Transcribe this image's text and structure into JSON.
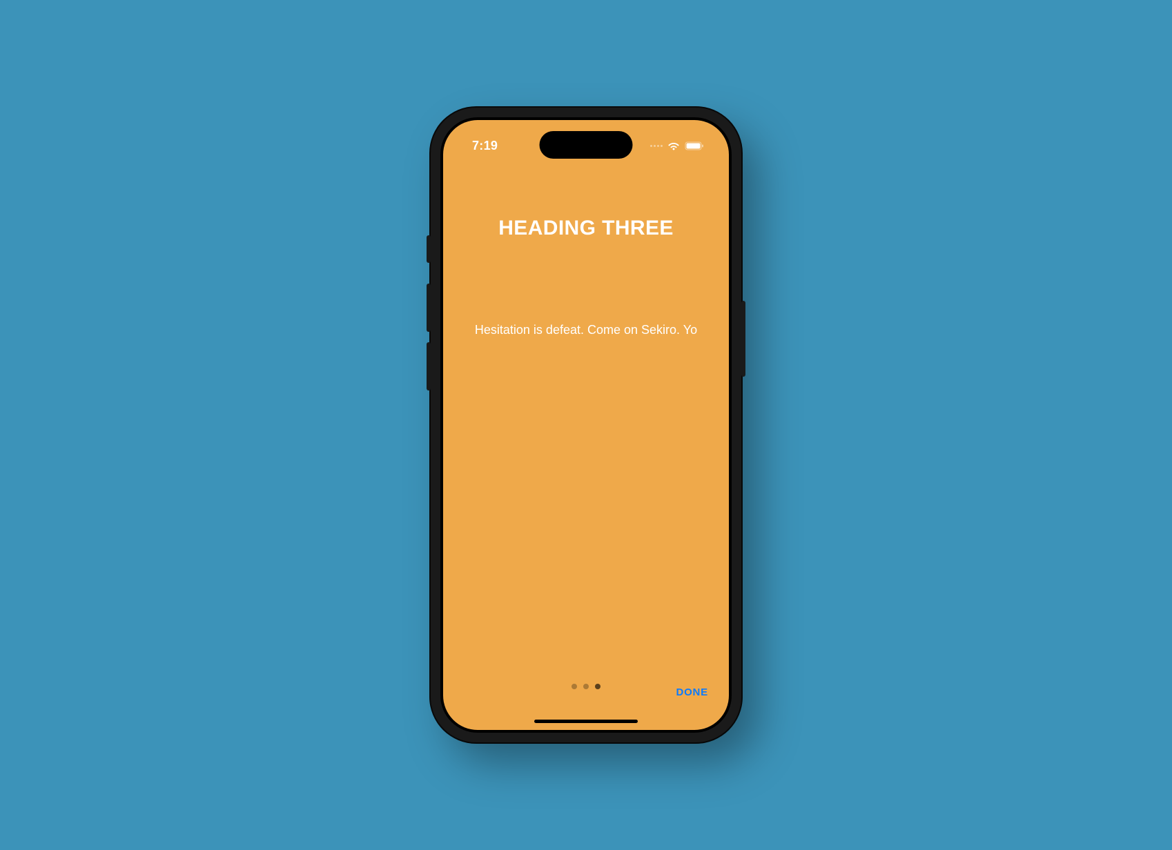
{
  "status_bar": {
    "time": "7:19"
  },
  "content": {
    "heading": "HEADING THREE",
    "body": "Hesitation is defeat. Come on Sekiro. Yo"
  },
  "pager": {
    "total": 3,
    "active_index": 2
  },
  "actions": {
    "done_label": "DONE"
  },
  "colors": {
    "page_background": "#3c93b9",
    "screen_background": "#efa94a",
    "done_button": "#0a7aff"
  }
}
